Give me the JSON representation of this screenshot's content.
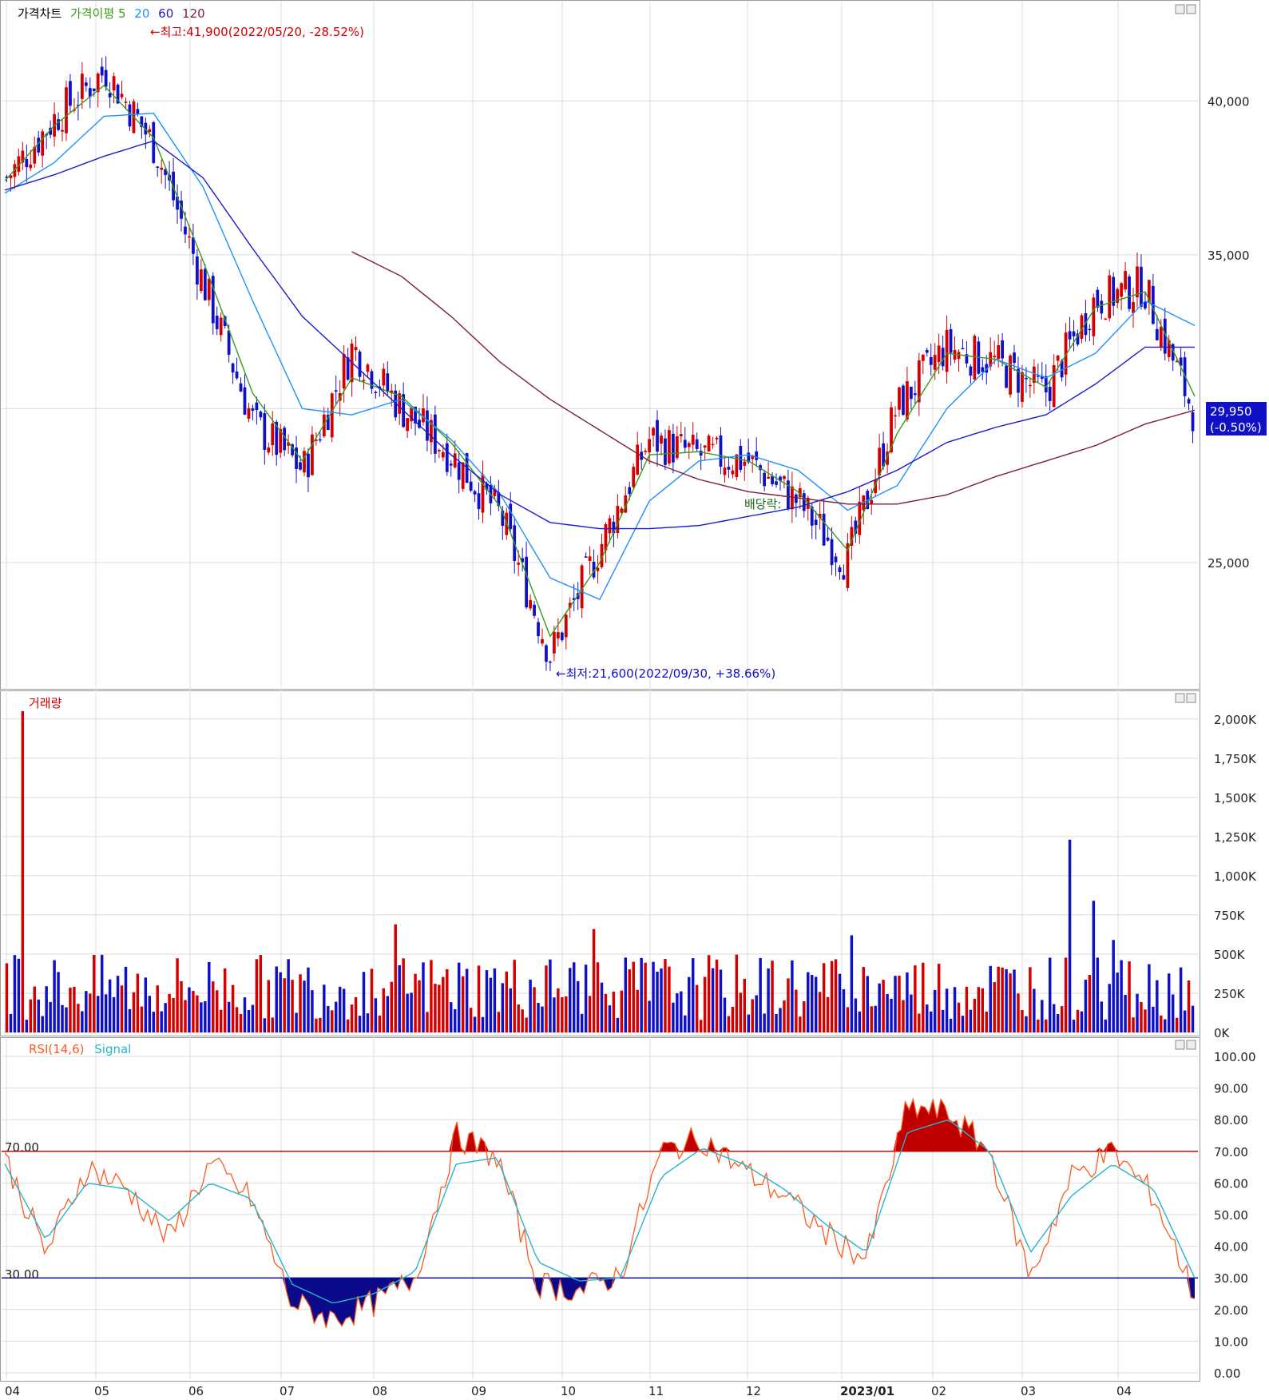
{
  "panels": {
    "price": {
      "legend": [
        {
          "label": "가격차트",
          "color": "#000000"
        },
        {
          "label": "가격이평 5",
          "color": "#3a9a1a"
        },
        {
          "label": "20",
          "color": "#1e90ff"
        },
        {
          "label": "60",
          "color": "#1a1acc"
        },
        {
          "label": "120",
          "color": "#7a1f3a"
        }
      ],
      "y_ticks": [
        "40,000",
        "35,000",
        "25,000"
      ],
      "annotations": {
        "high": "←최고:41,900(2022/05/20, -28.52%)",
        "low": "←최저:21,600(2022/09/30, +38.66%)",
        "dividend": "배당락:"
      },
      "current": {
        "price": "29,950",
        "change": "(-0.50%)"
      }
    },
    "volume": {
      "legend": [
        {
          "label": "거래량",
          "color": "#d40000"
        }
      ],
      "y_ticks": [
        "2,000K",
        "1,750K",
        "1,500K",
        "1,250K",
        "1,000K",
        "750K",
        "500K",
        "250K",
        "0K"
      ]
    },
    "rsi": {
      "legend": [
        {
          "label": "RSI(14,6)",
          "color": "#ff5a1f"
        },
        {
          "label": "Signal",
          "color": "#26b5c8"
        }
      ],
      "y_ticks": [
        "100.00",
        "90.00",
        "80.00",
        "70.00",
        "60.00",
        "50.00",
        "40.00",
        "30.00",
        "20.00",
        "10.00",
        "0.00"
      ],
      "upper_line": "70.00",
      "lower_line": "30.00"
    }
  },
  "x_ticks": [
    "04",
    "05",
    "06",
    "07",
    "08",
    "09",
    "10",
    "11",
    "12",
    "2023/01",
    "02",
    "03",
    "04"
  ],
  "colors": {
    "up": "#d40000",
    "down": "#1010c8",
    "ma5": "#3a9a1a",
    "ma20": "#1e90ff",
    "ma60": "#1a1acc",
    "ma120": "#7a1f3a",
    "rsi": "#ff5a1f",
    "signal": "#26b5c8",
    "grid": "#dcdcdc"
  },
  "chart_data": [
    {
      "type": "candlestick",
      "title": "가격차트",
      "ylim": [
        21000,
        42500
      ],
      "x_range": [
        "2022-04",
        "2023-04"
      ],
      "series": [
        {
          "name": "close",
          "x": [
            "2022-04",
            "2022-05",
            "2022-05",
            "2022-06",
            "2022-06",
            "2022-07",
            "2022-07",
            "2022-08",
            "2022-08",
            "2022-09",
            "2022-09",
            "2022-10",
            "2022-10",
            "2022-11",
            "2022-11",
            "2022-12",
            "2022-12",
            "2023-01",
            "2023-01",
            "2023-02",
            "2023-02",
            "2023-03",
            "2023-03",
            "2023-04",
            "2023-04"
          ],
          "values": [
            37500,
            39500,
            41000,
            38500,
            34000,
            29500,
            28000,
            32000,
            30000,
            28500,
            26500,
            22000,
            25500,
            29000,
            28500,
            28300,
            27000,
            25000,
            30000,
            32000,
            31500,
            30500,
            33500,
            34000,
            29950
          ]
        },
        {
          "name": "가격이평 5",
          "values": [
            37400,
            39200,
            40500,
            38800,
            34800,
            30500,
            28300,
            31000,
            30400,
            28900,
            26800,
            22600,
            25000,
            28500,
            28600,
            28300,
            27300,
            25400,
            29200,
            31800,
            31600,
            30700,
            33300,
            33800,
            30400
          ]
        },
        {
          "name": "20",
          "values": [
            37000,
            38000,
            39500,
            39600,
            37200,
            33500,
            30000,
            29800,
            30300,
            29000,
            27200,
            24500,
            23800,
            27000,
            28300,
            28500,
            28000,
            26700,
            27500,
            30000,
            31600,
            31000,
            31800,
            33500,
            32700
          ]
        },
        {
          "name": "60",
          "values": [
            37100,
            37600,
            38200,
            38700,
            37500,
            35200,
            33000,
            31500,
            30000,
            28500,
            27200,
            26300,
            26100,
            26100,
            26200,
            26500,
            26800,
            27300,
            28000,
            28900,
            29400,
            29800,
            30800,
            32000,
            32000
          ]
        },
        {
          "name": "120",
          "values": [
            null,
            null,
            null,
            null,
            null,
            null,
            null,
            35100,
            34300,
            33000,
            31500,
            30300,
            29300,
            28300,
            27700,
            27300,
            27100,
            26900,
            26900,
            27200,
            27800,
            28300,
            28800,
            29500,
            29950
          ]
        }
      ],
      "current_price": 29950,
      "current_change_pct": -0.5,
      "high": {
        "value": 41900,
        "date": "2022/05/20",
        "pct": -28.52
      },
      "low": {
        "value": 21600,
        "date": "2022/09/30",
        "pct": 38.66
      }
    },
    {
      "type": "bar",
      "title": "거래량",
      "ylim": [
        0,
        2050000
      ],
      "spikes": [
        {
          "at": "2022-04",
          "value": 2050000
        },
        {
          "at": "2023-03",
          "value": 1230000
        },
        {
          "at": "2023-03",
          "value": 840000
        },
        {
          "at": "2022-07",
          "value": 690000
        },
        {
          "at": "2022-10",
          "value": 660000
        }
      ],
      "typical_range": [
        100000,
        550000
      ]
    },
    {
      "type": "line",
      "title": "RSI(14,6)",
      "ylim": [
        0,
        100
      ],
      "thresholds": [
        70,
        30
      ],
      "series": [
        {
          "name": "RSI(14,6)",
          "values": [
            68,
            38,
            65,
            58,
            42,
            66,
            55,
            22,
            17,
            22,
            30,
            75,
            68,
            28,
            26,
            31,
            70,
            74,
            64,
            56,
            44,
            36,
            84,
            82,
            70,
            30,
            62,
            70,
            56,
            24
          ]
        },
        {
          "name": "Signal",
          "values": [
            66,
            42,
            60,
            58,
            48,
            60,
            55,
            28,
            22,
            25,
            32,
            66,
            68,
            35,
            29,
            30,
            62,
            71,
            66,
            58,
            47,
            38,
            76,
            80,
            70,
            38,
            56,
            66,
            58,
            30
          ]
        }
      ]
    }
  ]
}
